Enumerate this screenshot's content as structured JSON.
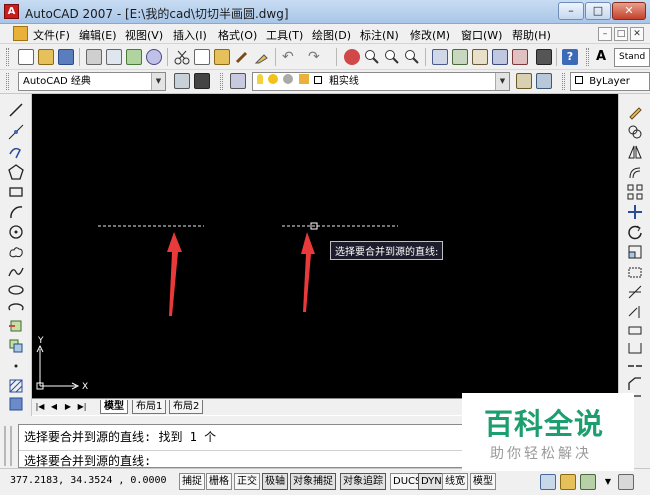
{
  "window": {
    "title": "AutoCAD 2007 - [E:\\我的cad\\切切半画圆.dwg]",
    "min_glyph": "–",
    "max_glyph": "□",
    "close_glyph": "✕"
  },
  "menu": {
    "items": [
      "文件(F)",
      "编辑(E)",
      "视图(V)",
      "插入(I)",
      "格式(O)",
      "工具(T)",
      "绘图(D)",
      "标注(N)",
      "修改(M)",
      "窗口(W)",
      "帮助(H)"
    ],
    "mdi_min": "–",
    "mdi_restore": "□",
    "mdi_close": "✕"
  },
  "toolbar": {
    "workspace": "AutoCAD 经典",
    "layer": "粗实线",
    "color": "ByLayer",
    "textstyle_partial": "Stand"
  },
  "canvas": {
    "background": "#000000",
    "ucs_x": "X",
    "ucs_y": "Y",
    "tooltip": "选择要合并到源的直线:",
    "arrow_color": "#e83a3a"
  },
  "tabs": {
    "nav": [
      "|◀",
      "◀",
      "▶",
      "▶|"
    ],
    "items": [
      "模型",
      "布局1",
      "布局2"
    ],
    "active": "模型"
  },
  "command": {
    "line1": "选择要合并到源的直线:  找到 1 个",
    "line2": "选择要合并到源的直线:"
  },
  "status": {
    "coords": "377.2183, 34.3524 , 0.0000",
    "buttons": [
      "捕捉",
      "栅格",
      "正交",
      "极轴",
      "对象捕捉",
      "对象追踪",
      "DUCS",
      "DYN",
      "线宽",
      "模型"
    ]
  },
  "watermark": {
    "title": "百科全说",
    "subtitle": "助你轻松解决"
  }
}
